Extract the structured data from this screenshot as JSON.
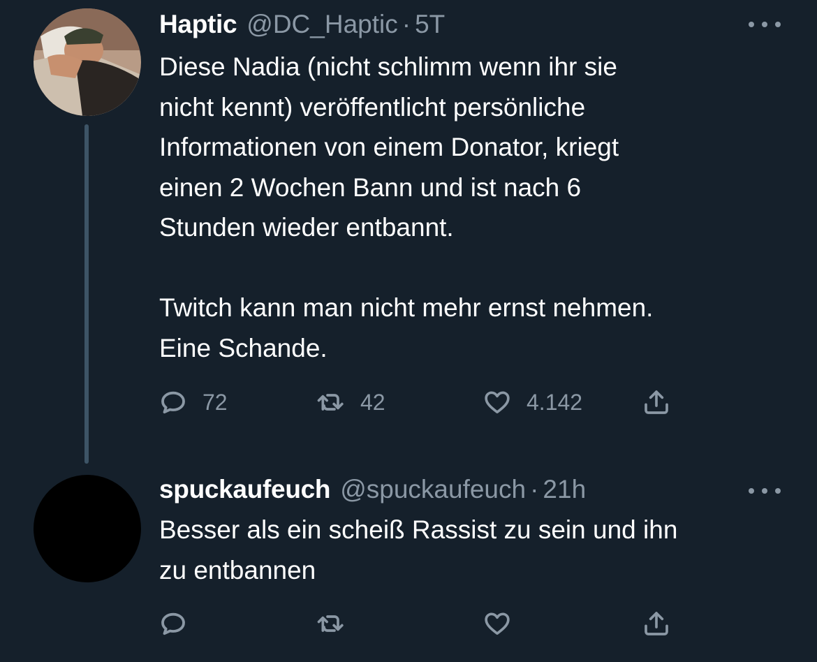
{
  "tweets": [
    {
      "name": "Haptic",
      "handle": "@DC_Haptic",
      "separator": "·",
      "time": "5T",
      "text": "Diese Nadia (nicht schlimm wenn ihr sie\nnicht kennt) veröffentlicht persönliche\nInformationen von einem Donator, kriegt\neinen 2 Wochen Bann und ist nach 6\nStunden wieder entbannt.\n\nTwitch kann man nicht mehr ernst nehmen.\nEine Schande.",
      "reply_count": "72",
      "retweet_count": "42",
      "like_count": "4.142"
    },
    {
      "name": "spuckaufeuch",
      "handle": "@spuckaufeuch",
      "separator": "·",
      "time": "21h",
      "text": "Besser als ein scheiß Rassist zu sein und ihn\nzu entbannen",
      "reply_count": "",
      "retweet_count": "",
      "like_count": ""
    }
  ],
  "icons": {
    "reply": "speech-bubble-icon",
    "retweet": "retweet-arrows-icon",
    "like": "heart-outline-icon",
    "share": "share-upload-icon",
    "more": "more-dots-icon"
  },
  "colors": {
    "background": "#15202b",
    "text": "#ffffff",
    "muted": "#8b98a5",
    "thread_line": "#3d5466"
  }
}
